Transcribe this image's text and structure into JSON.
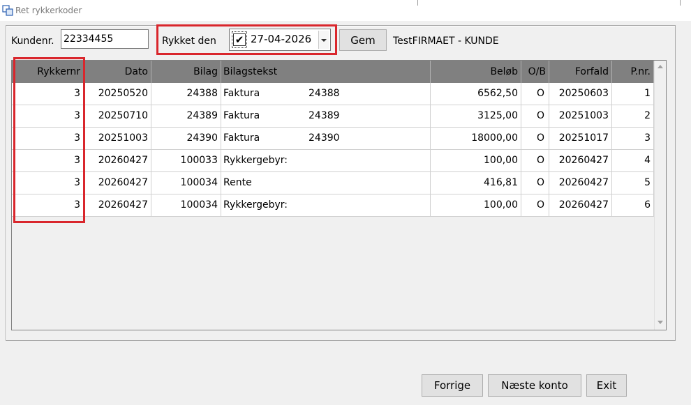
{
  "window": {
    "title": "Ret rykkerkoder"
  },
  "form": {
    "kundenr_label": "Kundenr.",
    "kundenr_value": "22334455",
    "rykket_label": "Rykket den",
    "rykket_checked": true,
    "rykket_check_glyph": "✔",
    "rykket_date": "27-04-2026",
    "gem_label": "Gem",
    "customer_name": "TestFIRMAET - KUNDE"
  },
  "table": {
    "headers": {
      "rykkernr": "Rykkernr",
      "dato": "Dato",
      "bilag": "Bilag",
      "bilagstekst": "Bilagstekst",
      "belob": "Beløb",
      "ob": "O/B",
      "forfald": "Forfald",
      "pnr": "P.nr."
    },
    "rows": [
      {
        "rykkernr": "3",
        "dato": "20250520",
        "bilag": "24388",
        "tekst": "Faktura",
        "tekst_ref": "24388",
        "belob": "6562,50",
        "ob": "O",
        "forfald": "20250603",
        "pnr": "1"
      },
      {
        "rykkernr": "3",
        "dato": "20250710",
        "bilag": "24389",
        "tekst": "Faktura",
        "tekst_ref": "24389",
        "belob": "3125,00",
        "ob": "O",
        "forfald": "20251003",
        "pnr": "2"
      },
      {
        "rykkernr": "3",
        "dato": "20251003",
        "bilag": "24390",
        "tekst": "Faktura",
        "tekst_ref": "24390",
        "belob": "18000,00",
        "ob": "O",
        "forfald": "20251017",
        "pnr": "3"
      },
      {
        "rykkernr": "3",
        "dato": "20260427",
        "bilag": "100033",
        "tekst": "Rykkergebyr:",
        "tekst_ref": "",
        "belob": "100,00",
        "ob": "O",
        "forfald": "20260427",
        "pnr": "4"
      },
      {
        "rykkernr": "3",
        "dato": "20260427",
        "bilag": "100034",
        "tekst": "Rente",
        "tekst_ref": "",
        "belob": "416,81",
        "ob": "O",
        "forfald": "20260427",
        "pnr": "5"
      },
      {
        "rykkernr": "3",
        "dato": "20260427",
        "bilag": "100034",
        "tekst": "Rykkergebyr:",
        "tekst_ref": "",
        "belob": "100,00",
        "ob": "O",
        "forfald": "20260427",
        "pnr": "6"
      }
    ]
  },
  "buttons": {
    "forrige": "Forrige",
    "naeste": "Næste konto",
    "exit": "Exit"
  },
  "colors": {
    "highlight": "#d9262c",
    "header_bg": "#808080"
  }
}
